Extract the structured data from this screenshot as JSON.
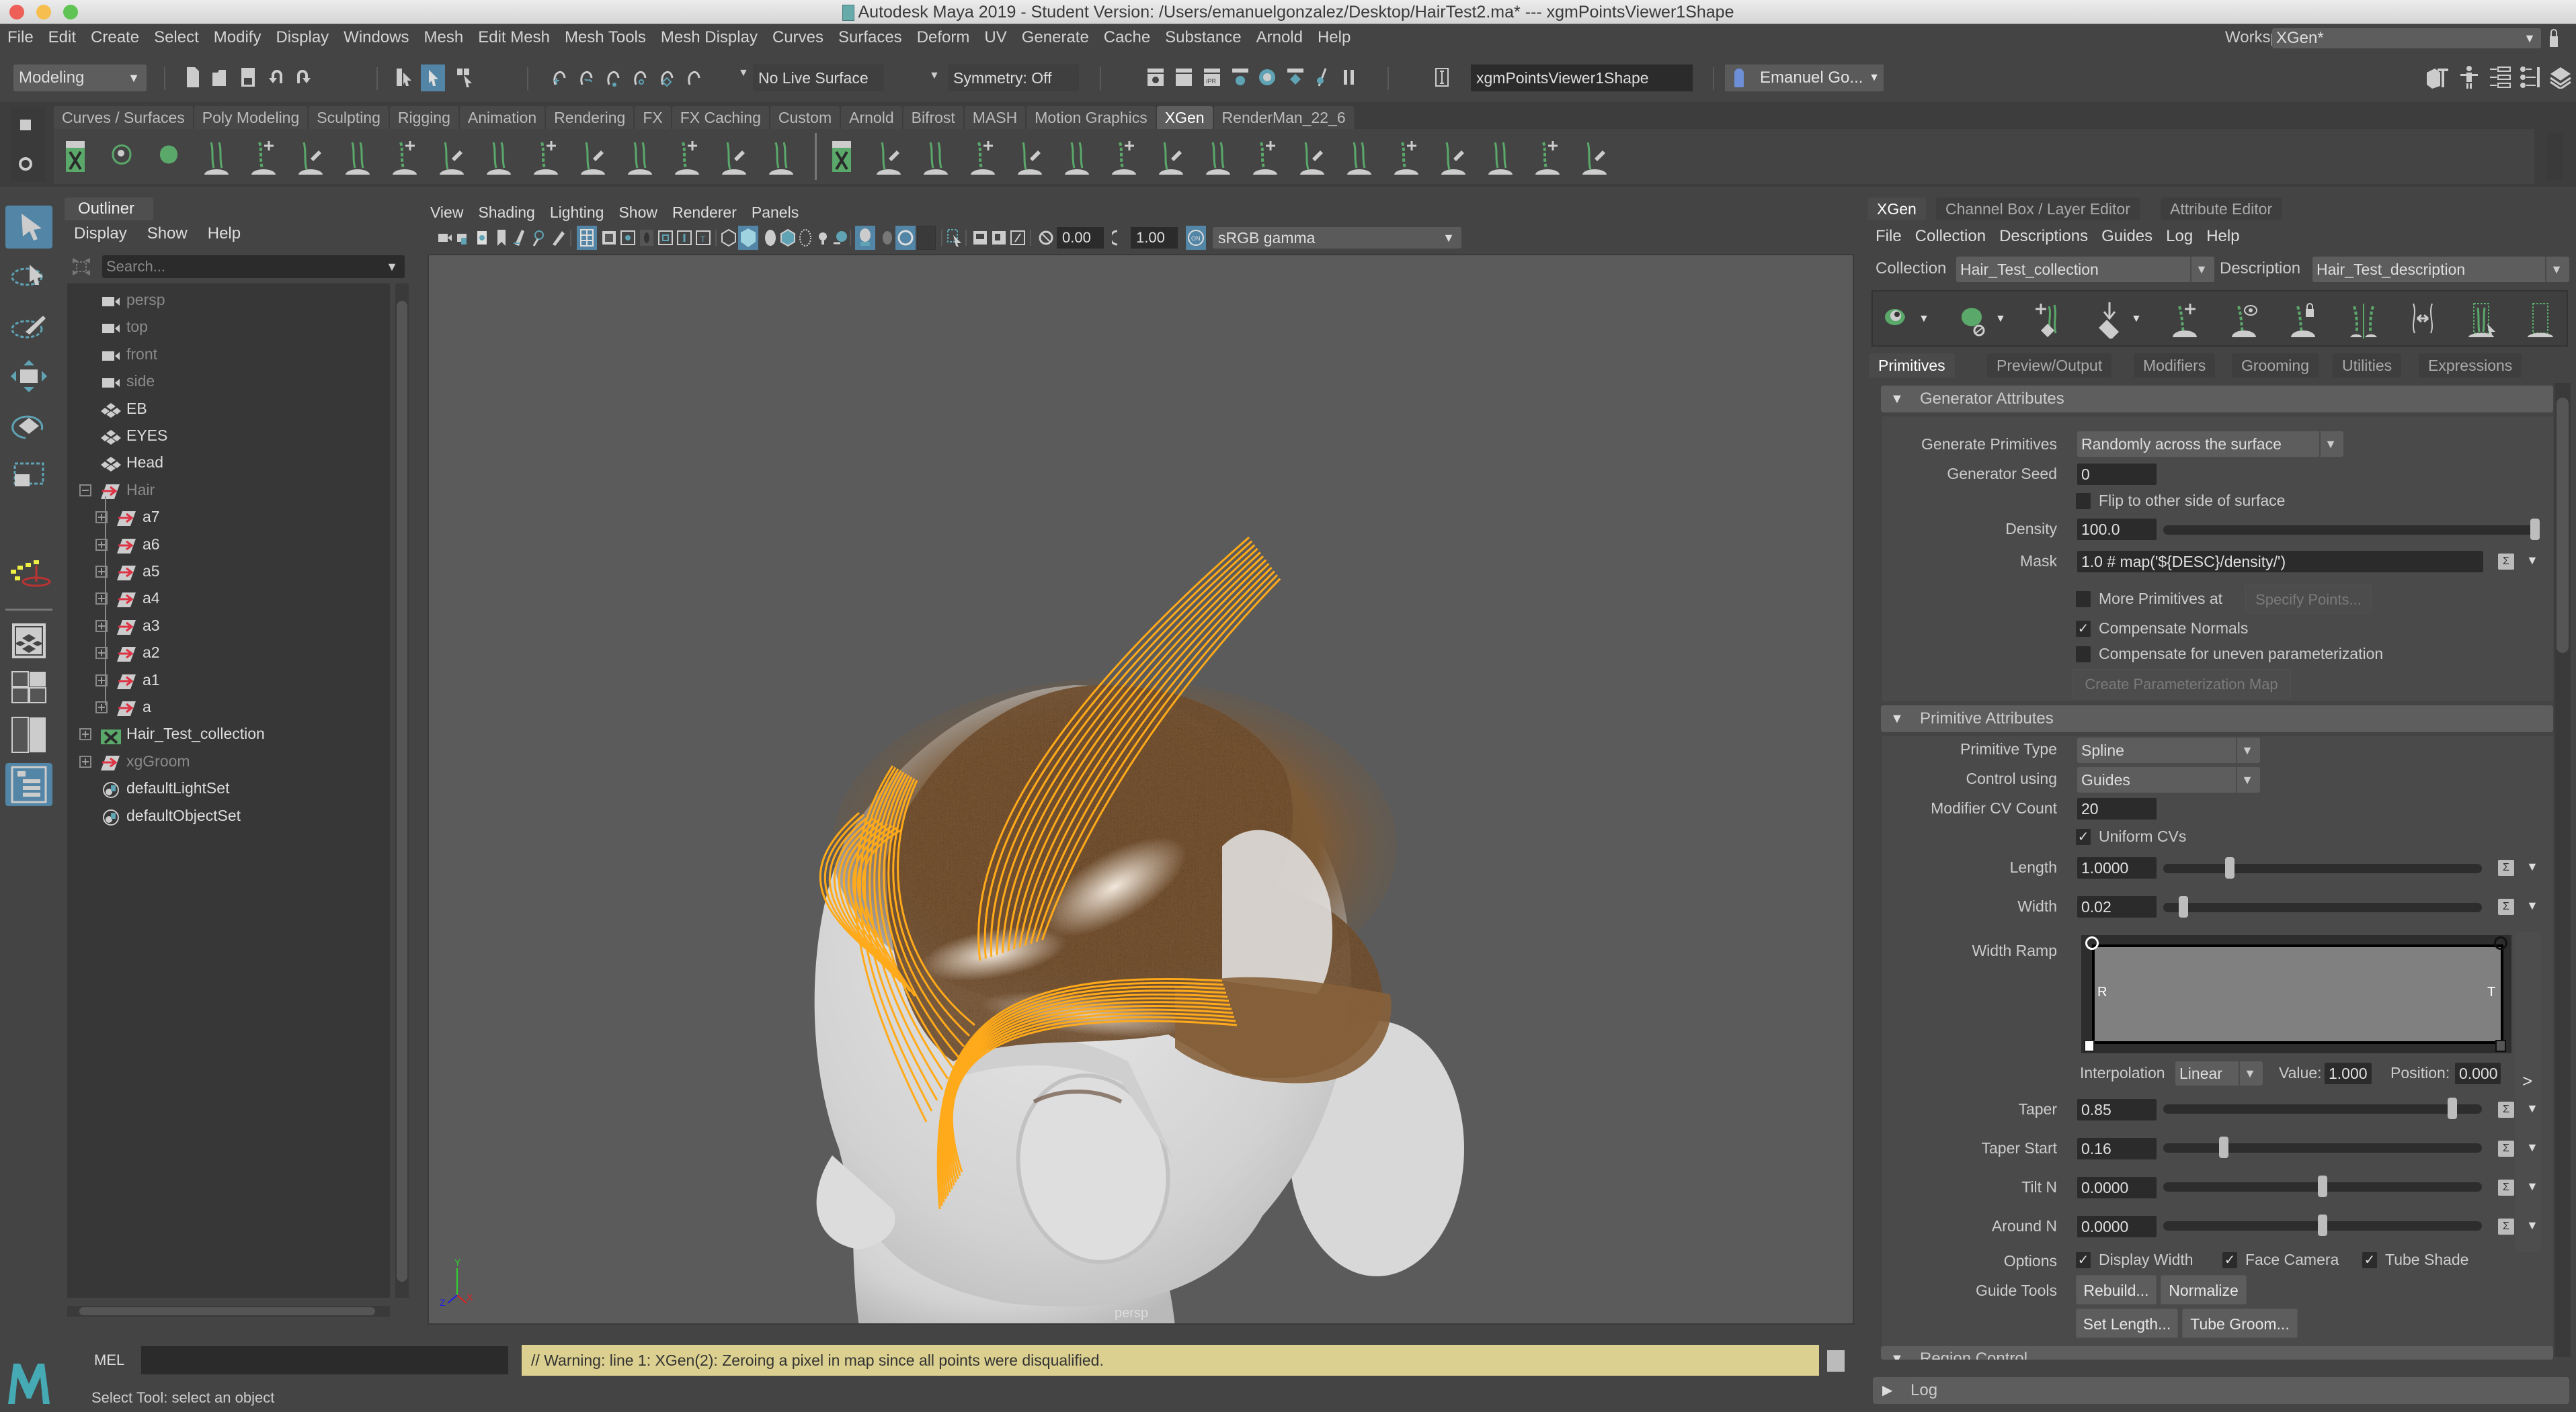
{
  "window": {
    "title": "Autodesk Maya 2019 - Student Version: /Users/emanuelgonzalez/Desktop/HairTest2.ma*  ---  xgmPointsViewer1Shape"
  },
  "main_menu": [
    "File",
    "Edit",
    "Create",
    "Select",
    "Modify",
    "Display",
    "Windows",
    "Mesh",
    "Edit Mesh",
    "Mesh Tools",
    "Mesh Display",
    "Curves",
    "Surfaces",
    "Deform",
    "UV",
    "Generate",
    "Cache",
    "Substance",
    "Arnold",
    "Help"
  ],
  "workspace": {
    "label": "Workspace :",
    "value": "XGen*"
  },
  "status_line": {
    "mode": "Modeling",
    "live_surface": "No Live Surface",
    "symmetry": "Symmetry: Off",
    "camera_field": "xgmPointsViewer1Shape",
    "user": "Emanuel Go..."
  },
  "shelf": {
    "tabs": [
      "Curves / Surfaces",
      "Poly Modeling",
      "Sculpting",
      "Rigging",
      "Animation",
      "Rendering",
      "FX",
      "FX Caching",
      "Custom",
      "Arnold",
      "Bifrost",
      "MASH",
      "Motion Graphics",
      "XGen",
      "RenderMan_22_6"
    ],
    "active_tab": "XGen",
    "icons": [
      "xgen-editor-icon",
      "guide-visibility-icon",
      "primitive-visibility-icon",
      "add-guides-icon",
      "place-guides-icon",
      "add-guide-icon",
      "show-guide-icon",
      "lock-guide-icon",
      "sculpt-guides-icon",
      "symmetry-icon",
      "guide-length-icon",
      "select-guide-icon",
      "rebuild-icon",
      "curves-to-guides-icon",
      "edit-guide-icon",
      "interactive-groom-editor-icon",
      "add-descriptions-icon",
      "grow-icon",
      "place-icon",
      "sculpt-brush-icon",
      "cut-icon",
      "smooth-icon",
      "comb-icon",
      "freeze-icon",
      "noise-icon",
      "clump-icon",
      "part-icon",
      "length-icon",
      "width-icon",
      "tube-icon",
      "grab-icon",
      "sync-icon",
      "convert-icon"
    ]
  },
  "toolbox": [
    "select-tool-icon",
    "lasso-tool-icon",
    "paint-select-tool-icon",
    "move-tool-icon",
    "rotate-tool-icon",
    "scale-tool-icon",
    "soft-mod-icon",
    "single-perspective-icon",
    "four-view-icon",
    "two-view-icon",
    "outliner-layout-icon"
  ],
  "outliner": {
    "tab": "Outliner",
    "menu": [
      "Display",
      "Show",
      "Help"
    ],
    "search_placeholder": "Search...",
    "items": [
      {
        "label": "persp",
        "type": "camera",
        "dim": true,
        "indent": 0
      },
      {
        "label": "top",
        "type": "camera",
        "dim": true,
        "indent": 0
      },
      {
        "label": "front",
        "type": "camera",
        "dim": true,
        "indent": 0
      },
      {
        "label": "side",
        "type": "camera",
        "dim": true,
        "indent": 0
      },
      {
        "label": "EB",
        "type": "mesh",
        "dim": false,
        "indent": 0
      },
      {
        "label": "EYES",
        "type": "mesh",
        "dim": false,
        "indent": 0
      },
      {
        "label": "Head",
        "type": "mesh",
        "dim": false,
        "indent": 0
      },
      {
        "label": "Hair",
        "type": "group",
        "dim": true,
        "indent": 0,
        "expander": "minus"
      },
      {
        "label": "a7",
        "type": "group",
        "dim": false,
        "indent": 1,
        "expander": "plus"
      },
      {
        "label": "a6",
        "type": "group",
        "dim": false,
        "indent": 1,
        "expander": "plus"
      },
      {
        "label": "a5",
        "type": "group",
        "dim": false,
        "indent": 1,
        "expander": "plus"
      },
      {
        "label": "a4",
        "type": "group",
        "dim": false,
        "indent": 1,
        "expander": "plus"
      },
      {
        "label": "a3",
        "type": "group",
        "dim": false,
        "indent": 1,
        "expander": "plus"
      },
      {
        "label": "a2",
        "type": "group",
        "dim": false,
        "indent": 1,
        "expander": "plus"
      },
      {
        "label": "a1",
        "type": "group",
        "dim": false,
        "indent": 1,
        "expander": "plus"
      },
      {
        "label": "a",
        "type": "group",
        "dim": false,
        "indent": 1,
        "expander": "plus"
      },
      {
        "label": "Hair_Test_collection",
        "type": "xgen",
        "dim": false,
        "indent": 0,
        "expander": "plus"
      },
      {
        "label": "xgGroom",
        "type": "group",
        "dim": true,
        "indent": 0,
        "expander": "plus"
      },
      {
        "label": "defaultLightSet",
        "type": "set",
        "dim": false,
        "indent": 0
      },
      {
        "label": "defaultObjectSet",
        "type": "set",
        "dim": false,
        "indent": 0
      }
    ]
  },
  "viewport": {
    "menu": [
      "View",
      "Shading",
      "Lighting",
      "Show",
      "Renderer",
      "Panels"
    ],
    "exposure": "0.00",
    "gamma": "1.00",
    "color_space": "sRGB gamma",
    "camera_label": "persp",
    "axis": {
      "x": "X",
      "y": "Y",
      "z": "Z"
    },
    "colors": {
      "guides": "#ffaa1a",
      "hair": "#7a5634",
      "head": "#d9d9d9",
      "background": "#5b5b5b"
    }
  },
  "right_panel": {
    "tabs": [
      "XGen",
      "Channel Box / Layer Editor",
      "Attribute Editor"
    ],
    "active_tab": "XGen",
    "menu": [
      "File",
      "Collection",
      "Descriptions",
      "Guides",
      "Log",
      "Help"
    ],
    "collection_label": "Collection",
    "collection_value": "Hair_Test_collection",
    "description_label": "Description",
    "description_value": "Hair_Test_description",
    "sub_tabs": [
      "Primitives",
      "Preview/Output",
      "Modifiers",
      "Grooming",
      "Utilities",
      "Expressions"
    ],
    "active_sub_tab": "Primitives",
    "generator": {
      "title": "Generator Attributes",
      "generate_primitives_label": "Generate Primitives",
      "generate_primitives": "Randomly across the surface",
      "seed_label": "Generator Seed",
      "seed": "0",
      "flip_label": "Flip to other side of surface",
      "flip": false,
      "density_label": "Density",
      "density": "100.0",
      "density_slider": 1.0,
      "mask_label": "Mask",
      "mask": "1.0 # map('${DESC}/density/')",
      "more_prims_label": "More Primitives at",
      "more_prims": false,
      "specify_points": "Specify Points...",
      "comp_normals_label": "Compensate Normals",
      "comp_normals": true,
      "comp_uneven_label": "Compensate for uneven parameterization",
      "comp_uneven": false,
      "create_param_map": "Create Parameterization Map"
    },
    "primitive": {
      "title": "Primitive Attributes",
      "type_label": "Primitive Type",
      "type": "Spline",
      "control_label": "Control using",
      "control": "Guides",
      "cv_count_label": "Modifier CV Count",
      "cv_count": "20",
      "uniform_cvs_label": "Uniform CVs",
      "uniform_cvs": true,
      "length_label": "Length",
      "length": "1.0000",
      "length_slider": 0.2,
      "width_label": "Width",
      "width": "0.02",
      "width_slider": 0.05,
      "width_ramp_label": "Width Ramp",
      "ramp_root": "R",
      "ramp_tip": "T",
      "interp_label": "Interpolation",
      "interp": "Linear",
      "value_label": "Value:",
      "value": "1.000",
      "position_label": "Position:",
      "position": "0.000",
      "taper_label": "Taper",
      "taper": "0.85",
      "taper_slider": 0.92,
      "taper_start_label": "Taper Start",
      "taper_start": "0.16",
      "taper_start_slider": 0.18,
      "tilt_label": "Tilt N",
      "tilt": "0.0000",
      "tilt_slider": 0.5,
      "around_label": "Around N",
      "around": "0.0000",
      "around_slider": 0.5,
      "options_label": "Options",
      "display_width_label": "Display Width",
      "display_width": true,
      "face_camera_label": "Face Camera",
      "face_camera": true,
      "tube_shade_label": "Tube Shade",
      "tube_shade": true,
      "guide_tools_label": "Guide Tools",
      "rebuild": "Rebuild...",
      "normalize": "Normalize",
      "set_length": "Set Length...",
      "tube_groom": "Tube Groom..."
    },
    "next_section": "Region Control",
    "log": "Log"
  },
  "command_line": {
    "language": "MEL",
    "warning": "// Warning: line 1: XGen(2):  Zeroing a pixel in map since all points were disqualified.",
    "help_line": "Select Tool: select an object"
  }
}
